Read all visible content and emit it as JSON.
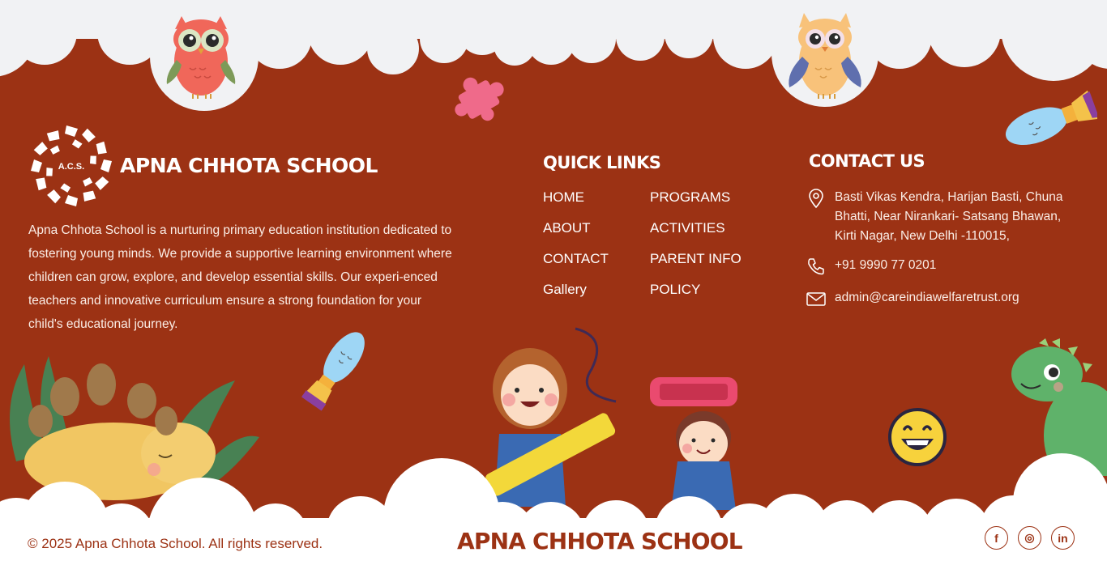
{
  "brand": {
    "name": "APNA CHHOTA SCHOOL",
    "logo_text": "A.C.S.",
    "description": "Apna Chhota School is a nurturing primary education institution dedicated to fostering young minds. We provide a supportive learning environment where children can grow, explore, and develop essential skills. Our experi-enced teachers and innovative curriculum ensure a strong foundation for your child's educational journey."
  },
  "quick_links": {
    "title": "QUICK LINKS",
    "items": [
      {
        "label": "HOME"
      },
      {
        "label": "PROGRAMS"
      },
      {
        "label": "ABOUT"
      },
      {
        "label": "ACTIVITIES"
      },
      {
        "label": "CONTACT"
      },
      {
        "label": "PARENT INFO"
      },
      {
        "label": "Gallery"
      },
      {
        "label": "POLICY"
      }
    ]
  },
  "contact": {
    "title": "CONTACT US",
    "address": "Basti Vikas Kendra, Harijan Basti, Chuna Bhatti, Near Nirankari- Satsang Bhawan, Kirti Nagar, New Delhi -110015,",
    "phone": "+91 9990 77 0201",
    "email": "admin@careindiawelfaretrust.org"
  },
  "footer": {
    "copyright": "© 2025 Apna Chhota School. All rights reserved.",
    "brand": "APNA CHHOTA SCHOOL",
    "social": [
      {
        "name": "facebook",
        "glyph": "f"
      },
      {
        "name": "instagram",
        "glyph": "◎"
      },
      {
        "name": "linkedin",
        "glyph": "in"
      }
    ]
  },
  "colors": {
    "background": "#9c3214",
    "cloud": "#ffffff",
    "top_cloud": "#f1f2f4",
    "text": "#ffffff"
  }
}
